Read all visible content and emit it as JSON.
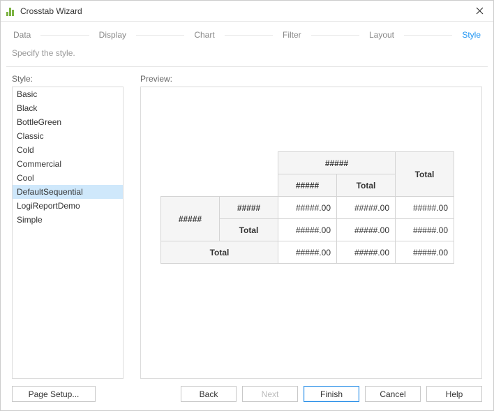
{
  "window": {
    "title": "Crosstab Wizard"
  },
  "steps": {
    "items": [
      "Data",
      "Display",
      "Chart",
      "Filter",
      "Layout",
      "Style"
    ],
    "activeIndex": 5
  },
  "subtitle": "Specify the style.",
  "style_section": {
    "label": "Style:",
    "items": [
      "Basic",
      "Black",
      "BottleGreen",
      "Classic",
      "Cold",
      "Commercial",
      "Cool",
      "DefaultSequential",
      "LogiReportDemo",
      "Simple"
    ],
    "selectedIndex": 7
  },
  "preview_section": {
    "label": "Preview:",
    "placeholder": "#####",
    "value_placeholder": "#####.00",
    "total_label": "Total"
  },
  "footer": {
    "page_setup": "Page Setup...",
    "back": "Back",
    "next": "Next",
    "finish": "Finish",
    "cancel": "Cancel",
    "help": "Help"
  }
}
